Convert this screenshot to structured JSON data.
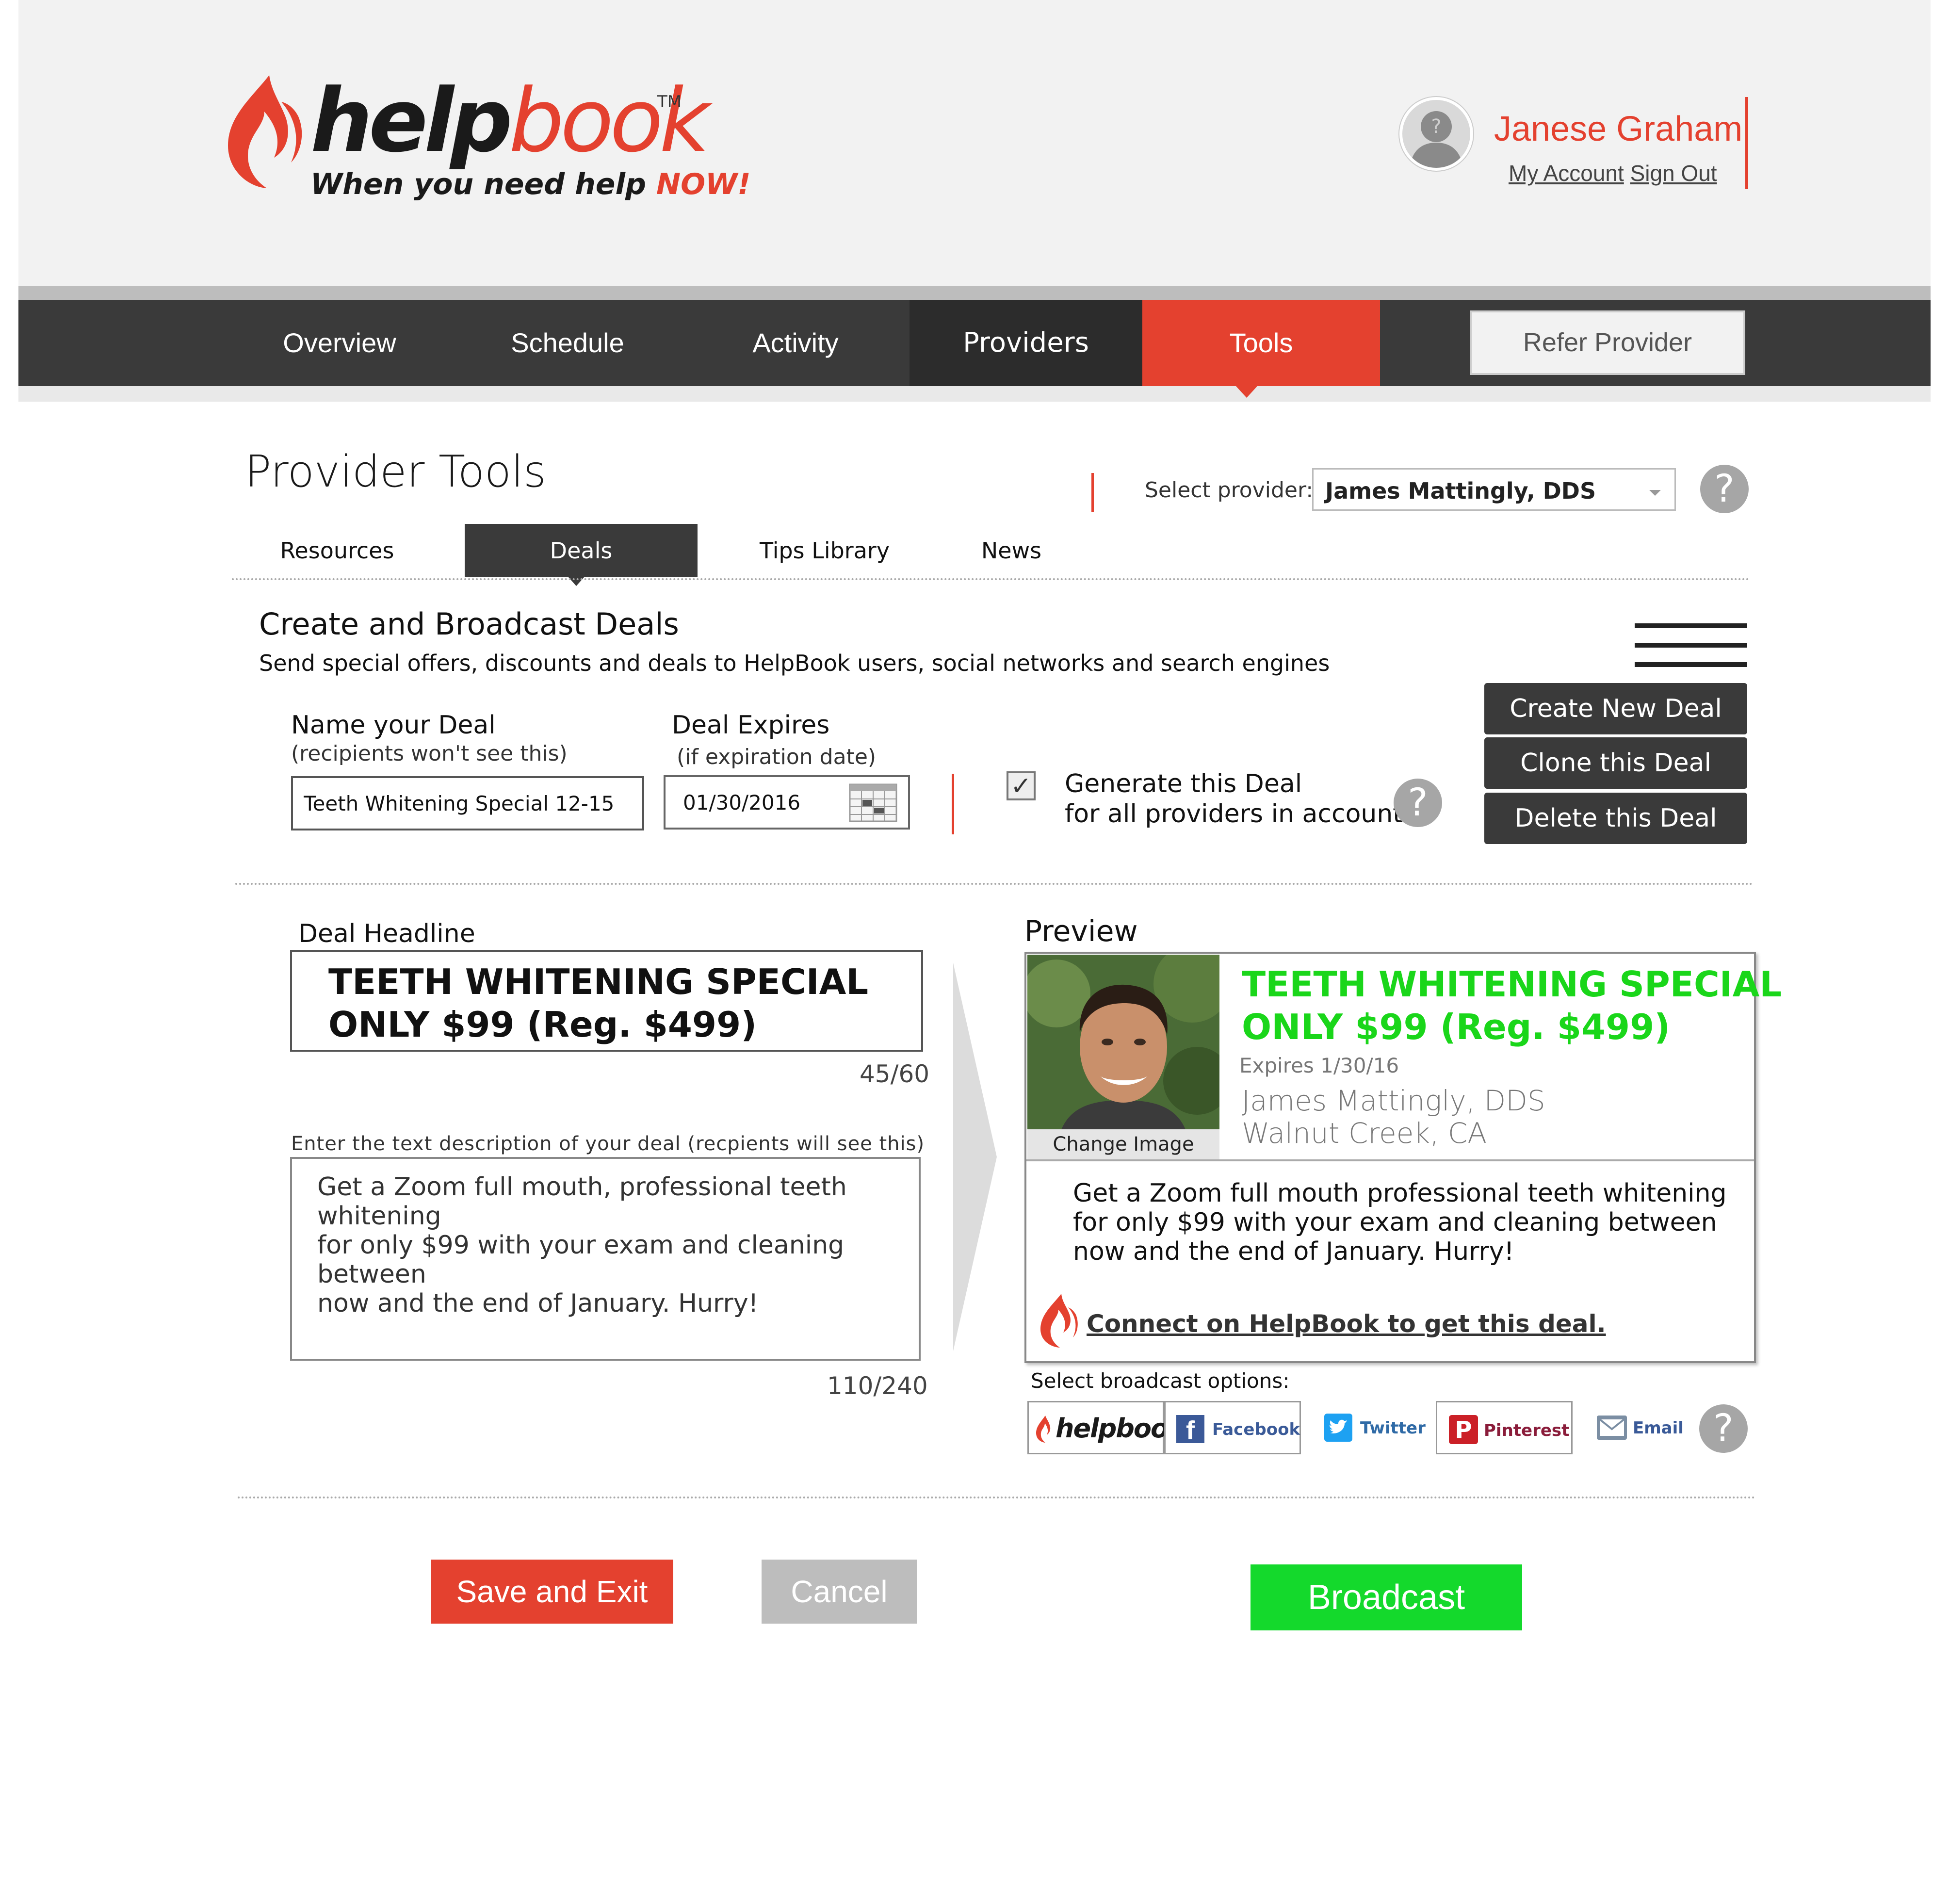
{
  "header": {
    "logo": {
      "help": "help",
      "book": "book",
      "tm": "TM",
      "tagline_prefix": "When you need help ",
      "tagline_now": "NOW!"
    },
    "user_name": "Janese Graham",
    "my_account": "My Account",
    "sign_out": "Sign Out"
  },
  "nav": {
    "items": [
      "Overview",
      "Schedule",
      "Activity",
      "Providers",
      "Tools"
    ],
    "active": "Tools",
    "refer_provider": "Refer Provider"
  },
  "page": {
    "title": "Provider Tools",
    "select_provider_label": "Select provider:",
    "selected_provider": "James Mattingly, DDS",
    "help_glyph": "?"
  },
  "subtabs": {
    "resources": "Resources",
    "deals": "Deals",
    "tips": "Tips Library",
    "news": "News"
  },
  "section": {
    "title": "Create and Broadcast Deals",
    "description": "Send special offers, discounts and deals to HelpBook users, social networks and search engines"
  },
  "actions": {
    "create": "Create New Deal",
    "clone": "Clone this Deal",
    "delete": "Delete this Deal"
  },
  "form": {
    "name_label": "Name your Deal",
    "name_sub": "(recipients won't see this)",
    "name_value": "Teeth Whitening Special 12-15",
    "expires_label": "Deal Expires",
    "expires_sub": "(if expiration date)",
    "expires_value": "01/30/2016",
    "generate_checked": "✓",
    "generate_line1": "Generate this Deal",
    "generate_line2": "for all providers in account",
    "headline_label": "Deal Headline",
    "headline_line1": "TEETH WHITENING SPECIAL",
    "headline_line2": "ONLY $99 (Reg. $499)",
    "headline_count": "45/60",
    "desc_label": "Enter the text description of your deal (recpients will see this)",
    "desc_line1": "Get a Zoom full mouth, professional teeth whitening",
    "desc_line2": "for only $99  with your exam and cleaning between",
    "desc_line3": "now and the end of January. Hurry!",
    "desc_count": "110/240"
  },
  "preview": {
    "label": "Preview",
    "change_image": "Change Image",
    "headline_line1": "TEETH WHITENING SPECIAL",
    "headline_line2": "ONLY $99 (Reg. $499)",
    "expires": "Expires 1/30/16",
    "provider": "James Mattingly, DDS",
    "location": "Walnut Creek, CA",
    "desc_line1": "Get a Zoom full mouth professional teeth whitening",
    "desc_line2": "for only $99 with your exam and cleaning between",
    "desc_line3": "now and the end of January. Hurry!",
    "connect": "Connect on HelpBook to get this deal."
  },
  "broadcast": {
    "label": "Select broadcast options:",
    "helpbook": "helpbook",
    "facebook": "Facebook",
    "twitter": "Twitter",
    "pinterest": "Pinterest",
    "email": "Email"
  },
  "footer": {
    "save": "Save and Exit",
    "cancel": "Cancel",
    "broadcast": "Broadcast"
  },
  "colors": {
    "brand_red": "#e4412f",
    "nav_dark": "#3a3a3a",
    "broadcast_green": "#14d92c",
    "preview_green": "#1ad61a",
    "cancel_gray": "#bdbdbd"
  }
}
